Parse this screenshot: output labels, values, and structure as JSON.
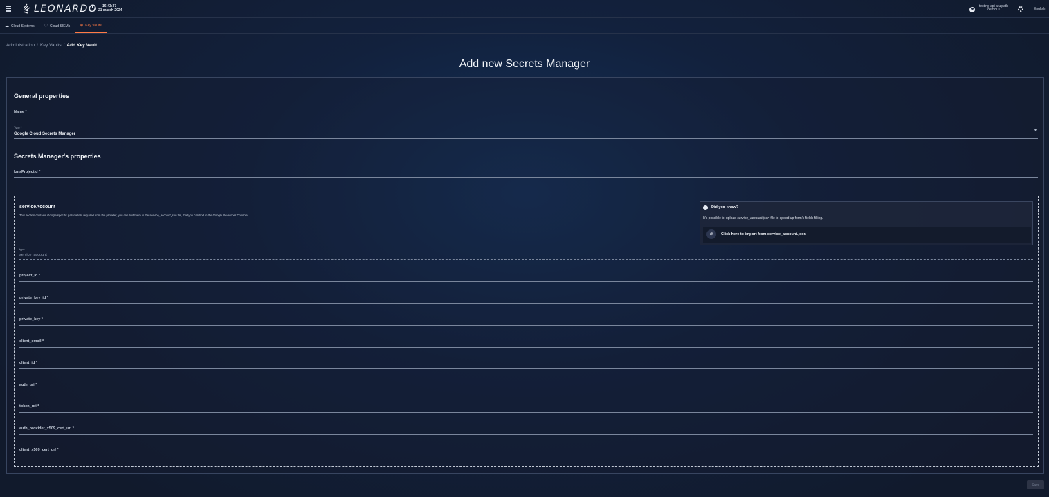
{
  "header": {
    "logo_text": "LEONARDO",
    "time": "16:43:37",
    "date": "21 march 2024",
    "user_line1": "testing api a ulpath",
    "user_line2": "demoUI",
    "language": "English"
  },
  "tabs": [
    {
      "label": "Cloud Systems",
      "icon": "cloud-icon"
    },
    {
      "label": "Cloud SIEMs",
      "icon": "shield-icon"
    },
    {
      "label": "Key Vaults",
      "icon": "key-icon"
    }
  ],
  "breadcrumb": {
    "item1": "Administration",
    "item2": "Key Vaults",
    "current": "Add Key Vault",
    "separator": "/"
  },
  "page_title": "Add new Secrets Manager",
  "general": {
    "heading": "General properties",
    "name_label": "Name *",
    "type_label": "Type *",
    "type_value": "Google Cloud Secrets Manager"
  },
  "secrets": {
    "heading": "Secrets Manager's properties",
    "kms_label": "kmsProjectId *"
  },
  "service_account": {
    "title": "serviceAccount",
    "desc_prefix": "This section contains Google specific parameters required from the provider, you can find them in the ",
    "desc_file": "service_account.json",
    "desc_suffix": " file, that you can find in the Google Developer Console.",
    "type_label": "type",
    "type_value": "service_account",
    "fields": [
      "project_id *",
      "private_key_id *",
      "private_key *",
      "client_email *",
      "client_id *",
      "auth_uri *",
      "token_uri *",
      "auth_provider_x509_cert_url *",
      "client_x509_cert_url *"
    ]
  },
  "tip": {
    "title": "Did you know?",
    "text_prefix": "It's possible to upload ",
    "text_file": "service_account.json",
    "text_suffix": " file to speed up form's fields filling.",
    "link_label": "Click here to import from service_account.json"
  },
  "save_label": "Save",
  "colors": {
    "accent": "#ff7a45",
    "background": "#12213d"
  }
}
